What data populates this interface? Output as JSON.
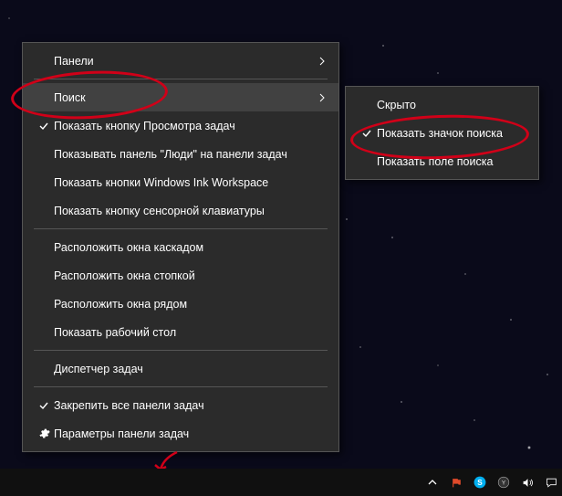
{
  "main_menu": {
    "panels": {
      "label": "Панели",
      "submenu": true
    },
    "search": {
      "label": "Поиск",
      "submenu": true,
      "highlighted": true
    },
    "task_view_btn": {
      "label": "Показать кнопку Просмотра задач",
      "checked": true
    },
    "people_bar": {
      "label": "Показывать панель \"Люди\" на панели задач"
    },
    "ink_workspace": {
      "label": "Показать кнопки Windows Ink Workspace"
    },
    "touch_kbd": {
      "label": "Показать кнопку сенсорной клавиатуры"
    },
    "cascade": {
      "label": "Расположить окна каскадом"
    },
    "stack": {
      "label": "Расположить окна стопкой"
    },
    "side_by_side": {
      "label": "Расположить окна рядом"
    },
    "show_desktop": {
      "label": "Показать рабочий стол"
    },
    "task_manager": {
      "label": "Диспетчер задач"
    },
    "lock_taskbars": {
      "label": "Закрепить все панели задач",
      "checked": true
    },
    "settings": {
      "label": "Параметры панели задач",
      "icon": "gear"
    }
  },
  "search_submenu": {
    "hidden": {
      "label": "Скрыто"
    },
    "show_icon": {
      "label": "Показать значок поиска",
      "checked": true
    },
    "show_field": {
      "label": "Показать поле поиска"
    }
  },
  "tray": {
    "up": "show-hidden-icons",
    "flag": "action-center-flag",
    "skype": "skype",
    "browser": "browser-y",
    "volume": "volume",
    "notif": "notifications"
  },
  "colors": {
    "annotation": "#d00018"
  }
}
